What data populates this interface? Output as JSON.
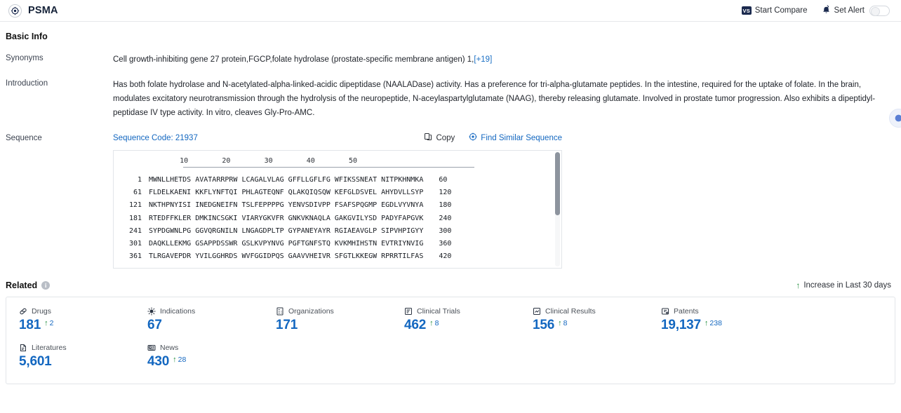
{
  "topbar": {
    "brand_name": "PSMA",
    "logo_icon": "target-icon",
    "start_compare_label": "Start Compare",
    "vs_badge": "VS",
    "set_alert_label": "Set Alert",
    "alert_icon": "bell-alert-icon",
    "toggle_state": "off"
  },
  "basic_info": {
    "title": "Basic Info",
    "synonyms_label": "Synonyms",
    "synonyms_value": "Cell growth-inhibiting gene 27 protein,FGCP,folate hydrolase (prostate-specific membrane antigen) 1,",
    "synonyms_more": "[+19]",
    "introduction_label": "Introduction",
    "introduction_value": "Has both folate hydrolase and N-acetylated-alpha-linked-acidic dipeptidase (NAALADase) activity. Has a preference for tri-alpha-glutamate peptides. In the intestine, required for the uptake of folate. In the brain, modulates excitatory neurotransmission through the hydrolysis of the neuropeptide, N-aceylaspartylglutamate (NAAG), thereby releasing glutamate. Involved in prostate tumor progression. Also exhibits a dipeptidyl-peptidase IV type activity. In vitro, cleaves Gly-Pro-AMC."
  },
  "sequence": {
    "label": "Sequence",
    "code_text": "Sequence Code: 21937",
    "copy_label": "Copy",
    "copy_icon": "copy-icon",
    "find_similar_label": "Find Similar Sequence",
    "find_similar_icon": "target-icon",
    "ruler": "        10        20        30        40        50",
    "rows": [
      {
        "start": "1",
        "residues": "MWNLLHETDS AVATARRPRW LCAGALVLAG GFFLLGFLFG WFIKSSNEAT NITPKHNMKA",
        "end": "60"
      },
      {
        "start": "61",
        "residues": "FLDELKAENI KKFLYNFTQI PHLAGTEQNF QLAKQIQSQW KEFGLDSVEL AHYDVLLSYP",
        "end": "120"
      },
      {
        "start": "121",
        "residues": "NKTHPNYISI INEDGNEIFN TSLFEPPPPG YENVSDIVPP FSAFSPQGMP EGDLVYVNYA",
        "end": "180"
      },
      {
        "start": "181",
        "residues": "RTEDFFKLER DMKINCSGKI VIARYGKVFR GNKVKNAQLA GAKGVILYSD PADYFAPGVK",
        "end": "240"
      },
      {
        "start": "241",
        "residues": "SYPDGWNLPG GGVQRGNILN LNGAGDPLTP GYPANEYAYR RGIAEAVGLP SIPVHPIGYY",
        "end": "300"
      },
      {
        "start": "301",
        "residues": "DAQKLLEKMG GSAPPDSSWR GSLKVPYNVG PGFTGNFSTQ KVKMHIHSTN EVTRIYNVIG",
        "end": "360"
      },
      {
        "start": "361",
        "residues": "TLRGAVEPDR YVILGGHRDS WVFGGIDPQS GAAVVHEIVR SFGTLKKEGW RPRRTILFAS",
        "end": "420"
      }
    ]
  },
  "related": {
    "title": "Related",
    "info_icon": "info-icon",
    "legend_label": "Increase in Last 30 days",
    "legend_icon": "up-arrow-icon",
    "accent_color": "#1367c0",
    "increase_color": "#1e8c3a",
    "stats": [
      {
        "label": "Drugs",
        "icon": "pill-icon",
        "value": "181",
        "delta": "2"
      },
      {
        "label": "Indications",
        "icon": "virus-icon",
        "value": "67",
        "delta": ""
      },
      {
        "label": "Organizations",
        "icon": "building-icon",
        "value": "171",
        "delta": ""
      },
      {
        "label": "Clinical Trials",
        "icon": "clinical-trial-icon",
        "value": "462",
        "delta": "8"
      },
      {
        "label": "Clinical Results",
        "icon": "clinical-result-icon",
        "value": "156",
        "delta": "8"
      },
      {
        "label": "Patents",
        "icon": "patent-icon",
        "value": "19,137",
        "delta": "238"
      },
      {
        "label": "Literatures",
        "icon": "literature-icon",
        "value": "5,601",
        "delta": ""
      },
      {
        "label": "News",
        "icon": "news-icon",
        "value": "430",
        "delta": "28"
      }
    ]
  }
}
